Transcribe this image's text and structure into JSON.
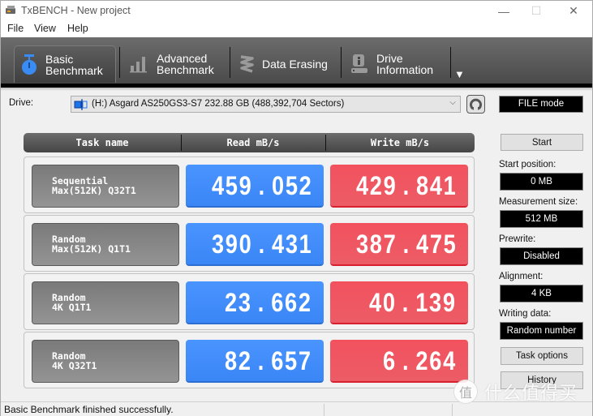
{
  "window": {
    "title": "TxBENCH - New project",
    "controls": {
      "minimize": "—",
      "maximize": "☐",
      "close": "✕"
    }
  },
  "menu": [
    "File",
    "View",
    "Help"
  ],
  "ribbon": {
    "tabs": [
      {
        "line1": "Basic",
        "line2": "Benchmark",
        "icon": "stopwatch-icon",
        "active": true
      },
      {
        "line1": "Advanced",
        "line2": "Benchmark",
        "icon": "bar-chart-icon",
        "active": false
      },
      {
        "line1": "Data Erasing",
        "line2": "",
        "icon": "eraser-spring-icon",
        "active": false
      },
      {
        "line1": "Drive",
        "line2": "Information",
        "icon": "drive-info-icon",
        "active": false
      }
    ],
    "more": "▼"
  },
  "drive": {
    "label": "Drive:",
    "selected": "(H:) Asgard AS250GS3-S7  232.88 GB (488,392,704 Sectors)"
  },
  "mode_badge": "FILE mode",
  "table": {
    "headers": [
      "Task name",
      "Read mB/s",
      "Write mB/s"
    ],
    "rows": [
      {
        "line1": "Sequential",
        "line2": "Max(512K) Q32T1",
        "read": "459.052",
        "write": "429.841"
      },
      {
        "line1": "Random",
        "line2": "Max(512K) Q1T1",
        "read": "390.431",
        "write": "387.475"
      },
      {
        "line1": "Random",
        "line2": "4K Q1T1",
        "read": "23.662",
        "write": "40.139"
      },
      {
        "line1": "Random",
        "line2": "4K Q32T1",
        "read": "82.657",
        "write": "6.264"
      }
    ]
  },
  "side": {
    "start": "Start",
    "start_position_label": "Start position:",
    "start_position": "0 MB",
    "measurement_size_label": "Measurement size:",
    "measurement_size": "512 MB",
    "prewrite_label": "Prewrite:",
    "prewrite": "Disabled",
    "alignment_label": "Alignment:",
    "alignment": "4 KB",
    "writing_data_label": "Writing data:",
    "writing_data": "Random number",
    "task_options": "Task options",
    "history": "History"
  },
  "status": "Basic Benchmark finished successfully.",
  "watermark": {
    "badge": "值",
    "text": "什么值得买"
  },
  "colors": {
    "read": "#3d89f8",
    "write": "#ef5560",
    "active_icon": "#3a8cf5"
  }
}
